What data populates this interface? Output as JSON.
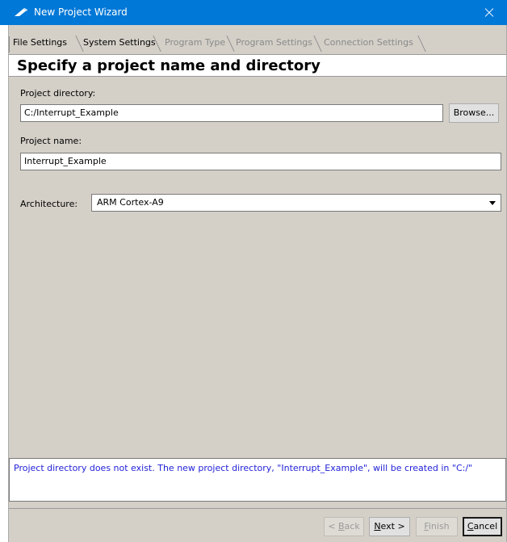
{
  "window": {
    "title": "New Project Wizard",
    "accent_color": "#0078d7",
    "background_color": "#d4d0c8"
  },
  "tabs": [
    {
      "label": "File Settings",
      "state": "active"
    },
    {
      "label": "System Settings",
      "state": "active"
    },
    {
      "label": "Program Type",
      "state": "disabled"
    },
    {
      "label": "Program Settings",
      "state": "disabled"
    },
    {
      "label": "Connection Settings",
      "state": "disabled"
    }
  ],
  "header": {
    "title": "Specify a project name and directory"
  },
  "form": {
    "project_directory": {
      "label": "Project directory:",
      "value": "C:/Interrupt_Example"
    },
    "browse_label": "Browse...",
    "project_name": {
      "label": "Project name:",
      "value": "Interrupt_Example"
    },
    "architecture": {
      "label": "Architecture:",
      "value": "ARM Cortex-A9"
    }
  },
  "message": "Project directory does not exist. The new project directory, \"Interrupt_Example\", will be created in \"C:/\"",
  "footer": {
    "back": {
      "mnemonic": "B",
      "rest": "ack",
      "prefix": "< ",
      "enabled": false
    },
    "next": {
      "mnemonic": "N",
      "rest": "ext >",
      "enabled": true
    },
    "finish": {
      "mnemonic": "F",
      "rest": "inish",
      "enabled": false
    },
    "cancel": {
      "mnemonic": "C",
      "rest": "ancel",
      "enabled": true
    }
  }
}
